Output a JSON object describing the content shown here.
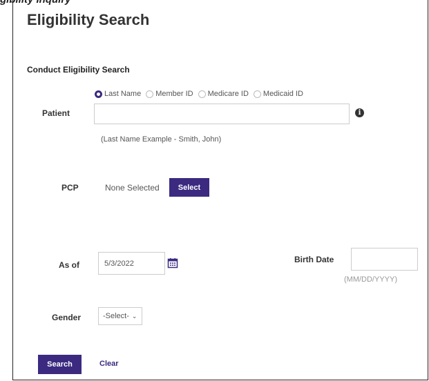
{
  "header": {
    "clipped_text": "gibility Inquiry",
    "title": "Eligibility Search"
  },
  "form": {
    "section_title": "Conduct Eligibility Search",
    "search_types": [
      "Last Name",
      "Member ID",
      "Medicare ID",
      "Medicaid ID"
    ],
    "selected_search_type": "Last Name",
    "patient": {
      "label": "Patient",
      "value": "",
      "hint": "(Last Name Example - Smith, John)"
    },
    "pcp": {
      "label": "PCP",
      "value": "None Selected",
      "select_label": "Select"
    },
    "as_of": {
      "label": "As of",
      "value": "5/3/2022"
    },
    "birth_date": {
      "label": "Birth Date",
      "value": "",
      "hint": "(MM/DD/YYYY)"
    },
    "gender": {
      "label": "Gender",
      "value": "-Select-"
    },
    "search_label": "Search",
    "clear_label": "Clear"
  },
  "colors": {
    "accent": "#3b2a80"
  }
}
